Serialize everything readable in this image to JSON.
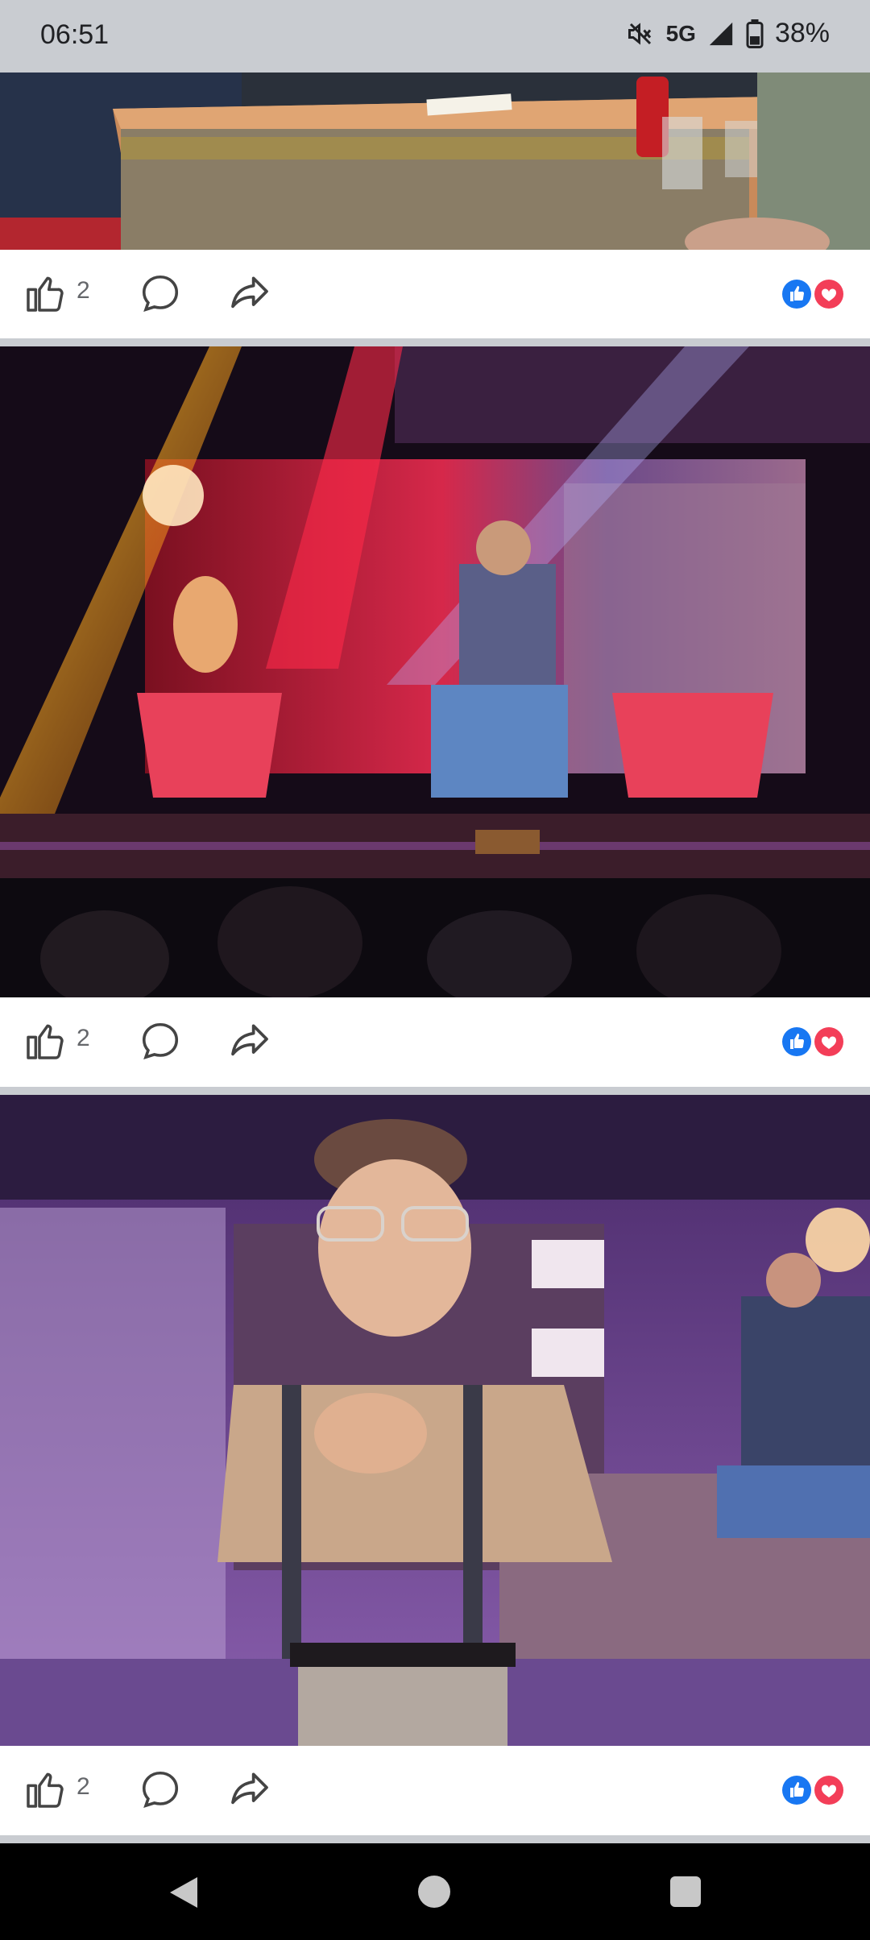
{
  "status_bar": {
    "time": "06:51",
    "network": "5G",
    "battery": "38%"
  },
  "posts": [
    {
      "like_count": "2"
    },
    {
      "like_count": "2"
    },
    {
      "like_count": "2"
    }
  ],
  "colors": {
    "like_blue": "#1877f2",
    "love_red": "#f33e58",
    "icon_gray": "#65676b",
    "divider": "#c9ccd1"
  },
  "icons": [
    "mute-icon",
    "signal-icon",
    "battery-icon",
    "like-icon",
    "comment-icon",
    "share-icon",
    "reaction-like-icon",
    "reaction-love-icon",
    "back-icon",
    "home-icon",
    "recents-icon"
  ]
}
